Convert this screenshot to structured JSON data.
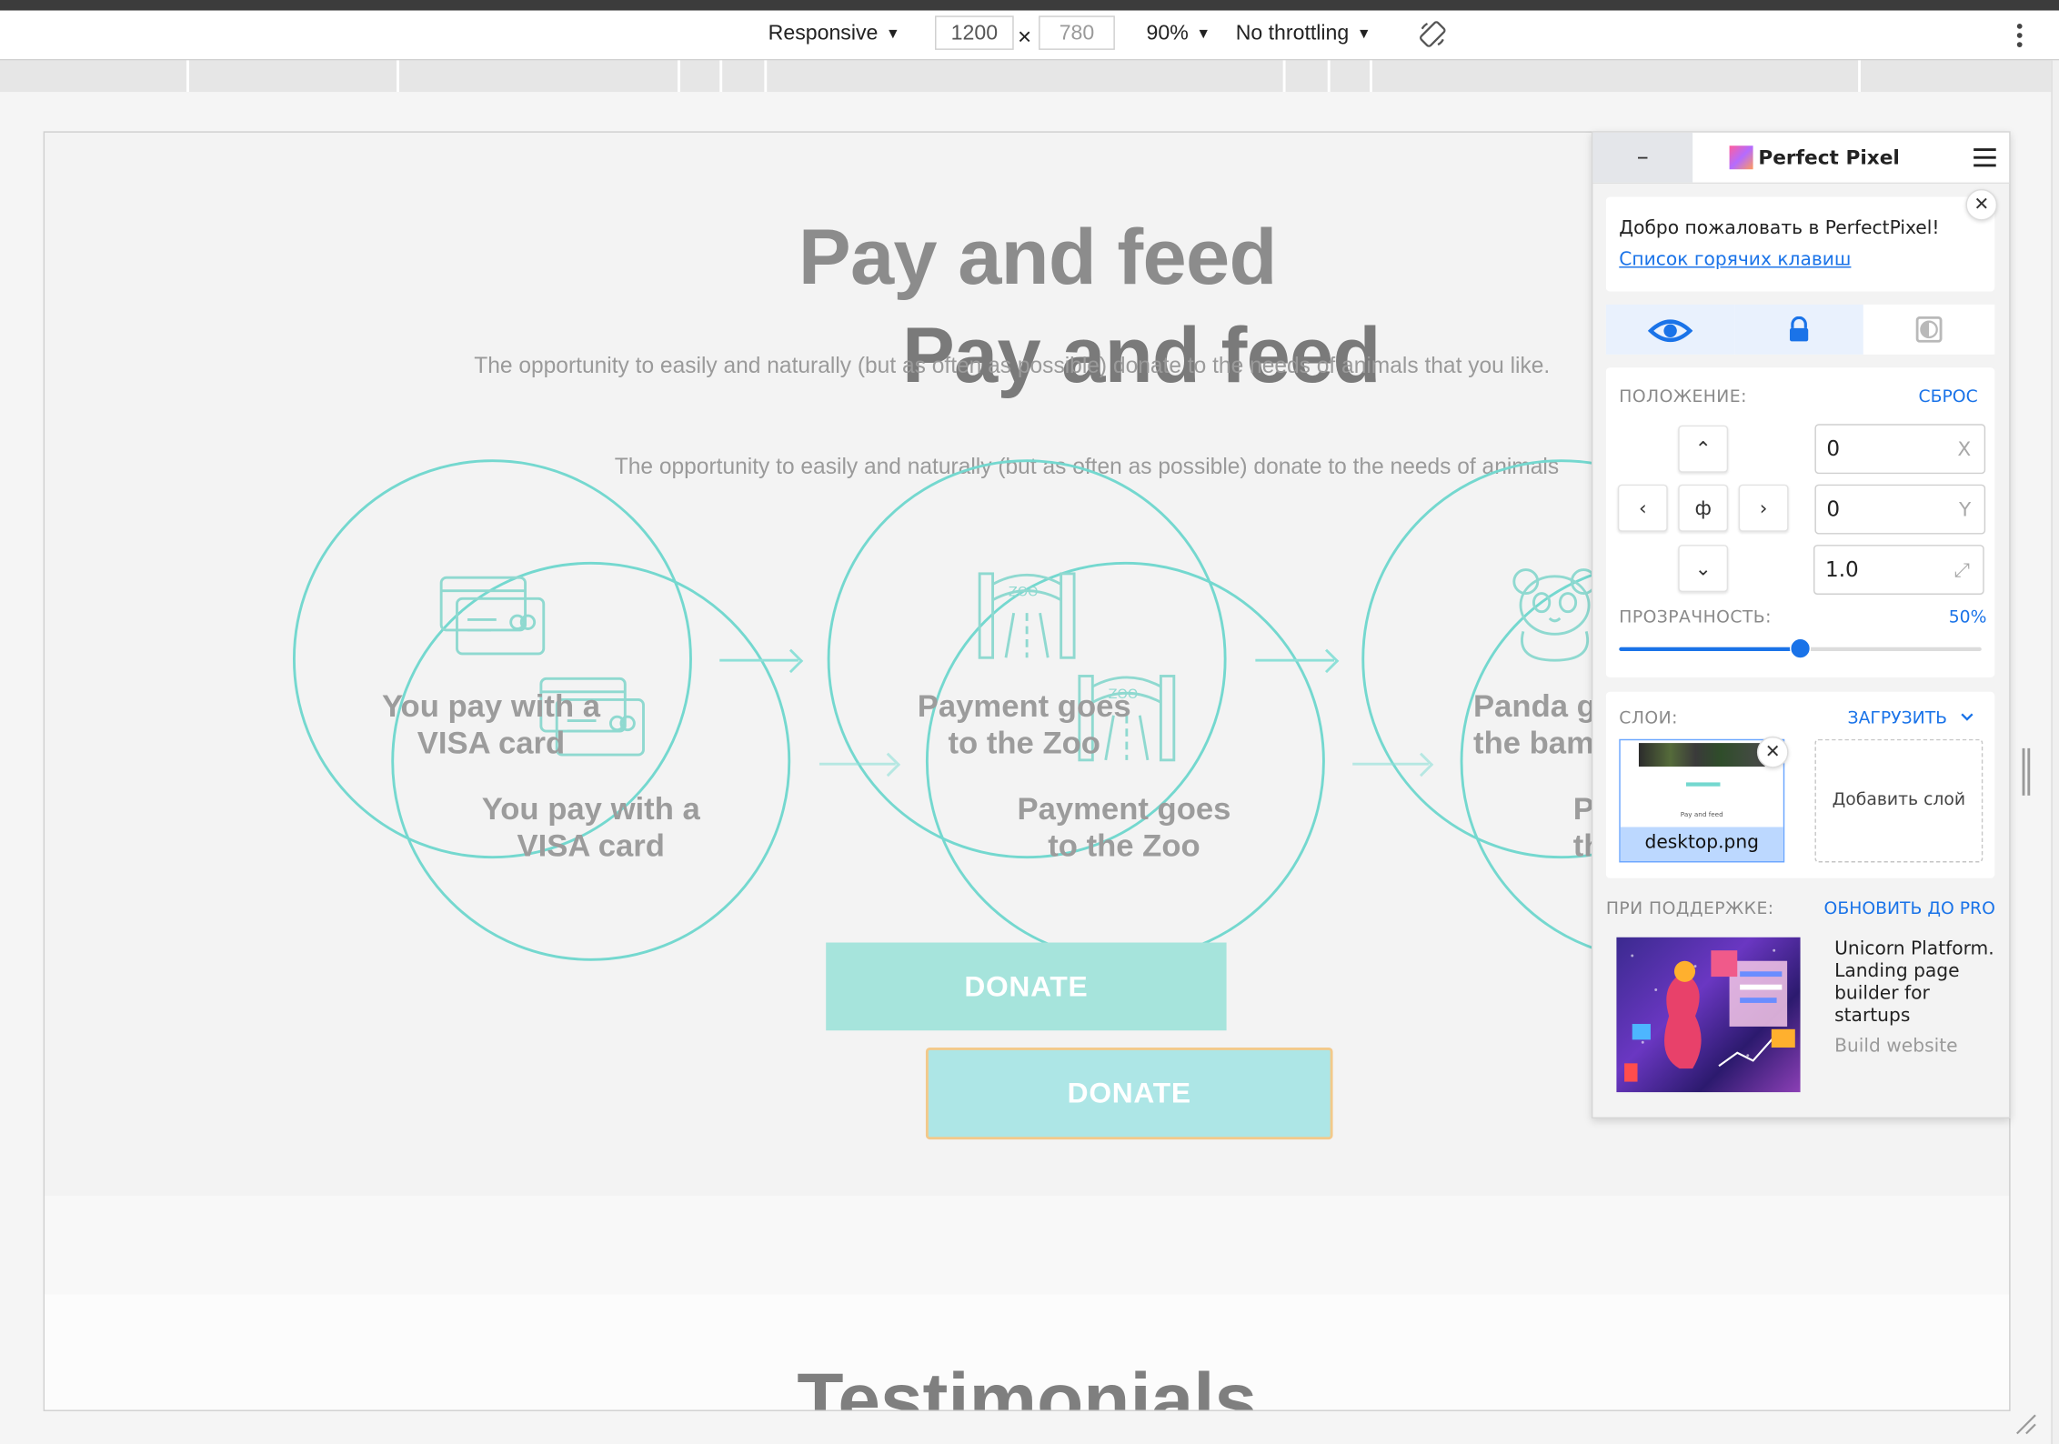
{
  "devtools": {
    "device": "Responsive",
    "width": "1200",
    "times": "×",
    "height": "780",
    "zoom": "90%",
    "throttle": "No throttling"
  },
  "page": {
    "title": "Pay and feed",
    "subtitle": "The opportunity to easily and naturally (but as often as possible) donate to the needs of animals that you like.",
    "subtitle_overlay": "The opportunity to easily and naturally (but as often as possible) donate to the needs of animals",
    "steps": [
      {
        "line1": "You pay with a",
        "line2": "VISA card"
      },
      {
        "line1": "Payment goes",
        "line2": "to the Zoo"
      },
      {
        "line1": "Panda goes to",
        "line2": "the bamboo"
      }
    ],
    "step3_overlay": {
      "line1": "P",
      "line2": "th"
    },
    "donate": "DONATE",
    "testimonials": "Testimonials"
  },
  "panel": {
    "minimize": "–",
    "title": "Perfect Pixel",
    "welcome": "Добро пожаловать в PerfectPixel!",
    "hotkeys_link": "Список горячих клавиш",
    "close_glyph": "✕",
    "position_label": "ПОЛОЖЕНИЕ:",
    "reset": "СБРОС",
    "nav": {
      "up": "⌃",
      "left": "‹",
      "center": "ф",
      "right": "›",
      "down": "⌄"
    },
    "x_value": "0",
    "x_axis": "X",
    "y_value": "0",
    "y_axis": "Y",
    "scale_value": "1.0",
    "scale_icon": "⤢",
    "opacity_label": "ПРОЗРАЧНОСТЬ:",
    "opacity_value": "50%",
    "opacity_fraction": 0.5,
    "layers_label": "СЛОИ:",
    "upload": "ЗАГРУЗИТЬ",
    "layer_name": "desktop.png",
    "thumb_title": "Pay and feed",
    "add_layer": "Добавить слой",
    "support_label": "ПРИ ПОДДЕРЖКЕ:",
    "upgrade": "ОБНОВИТЬ ДО PRO",
    "promo_title": "Unicorn Platform. Landing page builder for startups",
    "promo_sub": "Build website"
  },
  "colors": {
    "accent": "#1a73e8",
    "teal": "#74d8cf",
    "donate_bg": "#a6e4dc",
    "donate_bg2": "#ade6e6",
    "donate_border": "#f3c98a"
  },
  "icons": [
    "more-vert-icon",
    "rotate-icon",
    "eye-icon",
    "lock-icon",
    "invert-icon",
    "credit-card-icon",
    "zoo-gate-icon",
    "panda-icon",
    "hamburger-icon",
    "close-icon",
    "arrow-up-icon",
    "arrow-left-icon",
    "arrow-right-icon",
    "arrow-down-icon",
    "center-icon",
    "resize-icon",
    "chevron-down-icon"
  ]
}
